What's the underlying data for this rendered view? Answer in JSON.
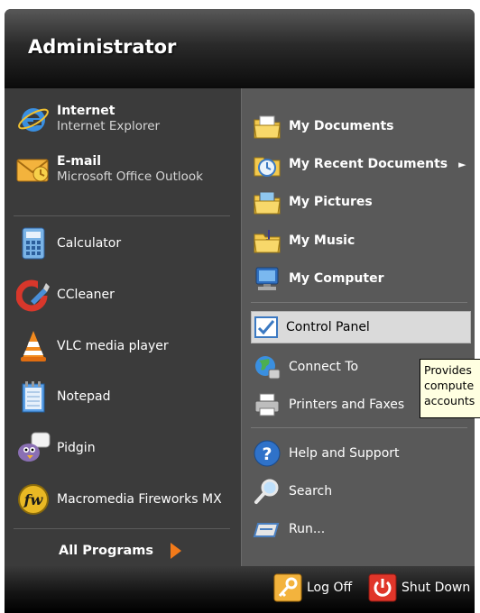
{
  "header": {
    "user_name": "Administrator"
  },
  "pinned": [
    {
      "title": "Internet",
      "subtitle": "Internet Explorer"
    },
    {
      "title": "E-mail",
      "subtitle": "Microsoft Office Outlook"
    }
  ],
  "recent_programs": [
    "Calculator",
    "CCleaner",
    "VLC media player",
    "Notepad",
    "Pidgin",
    "Macromedia Fireworks MX"
  ],
  "all_programs": {
    "label": "All Programs"
  },
  "places_top": [
    {
      "label": "My Documents"
    },
    {
      "label": "My Recent Documents",
      "arrow": "►"
    },
    {
      "label": "My Pictures"
    },
    {
      "label": "My Music"
    },
    {
      "label": "My Computer"
    }
  ],
  "places_mid": [
    {
      "label": "Control Panel",
      "highlighted": true
    },
    {
      "label": "Connect To",
      "arrow": "►"
    },
    {
      "label": "Printers and Faxes"
    }
  ],
  "places_bottom": [
    {
      "label": "Help and Support"
    },
    {
      "label": "Search"
    },
    {
      "label": "Run..."
    }
  ],
  "tooltip": {
    "lines": [
      "Provides",
      "compute",
      "accounts"
    ]
  },
  "footer": {
    "log_off": "Log Off",
    "shut_down": "Shut Down"
  },
  "colors": {
    "header": "#0b0b0b",
    "left_panel": "#3b3b3b",
    "right_panel": "#595959",
    "highlight": "#dadada",
    "all_programs_arrow": "#f27a1a",
    "shutdown_red": "#e0362a"
  }
}
